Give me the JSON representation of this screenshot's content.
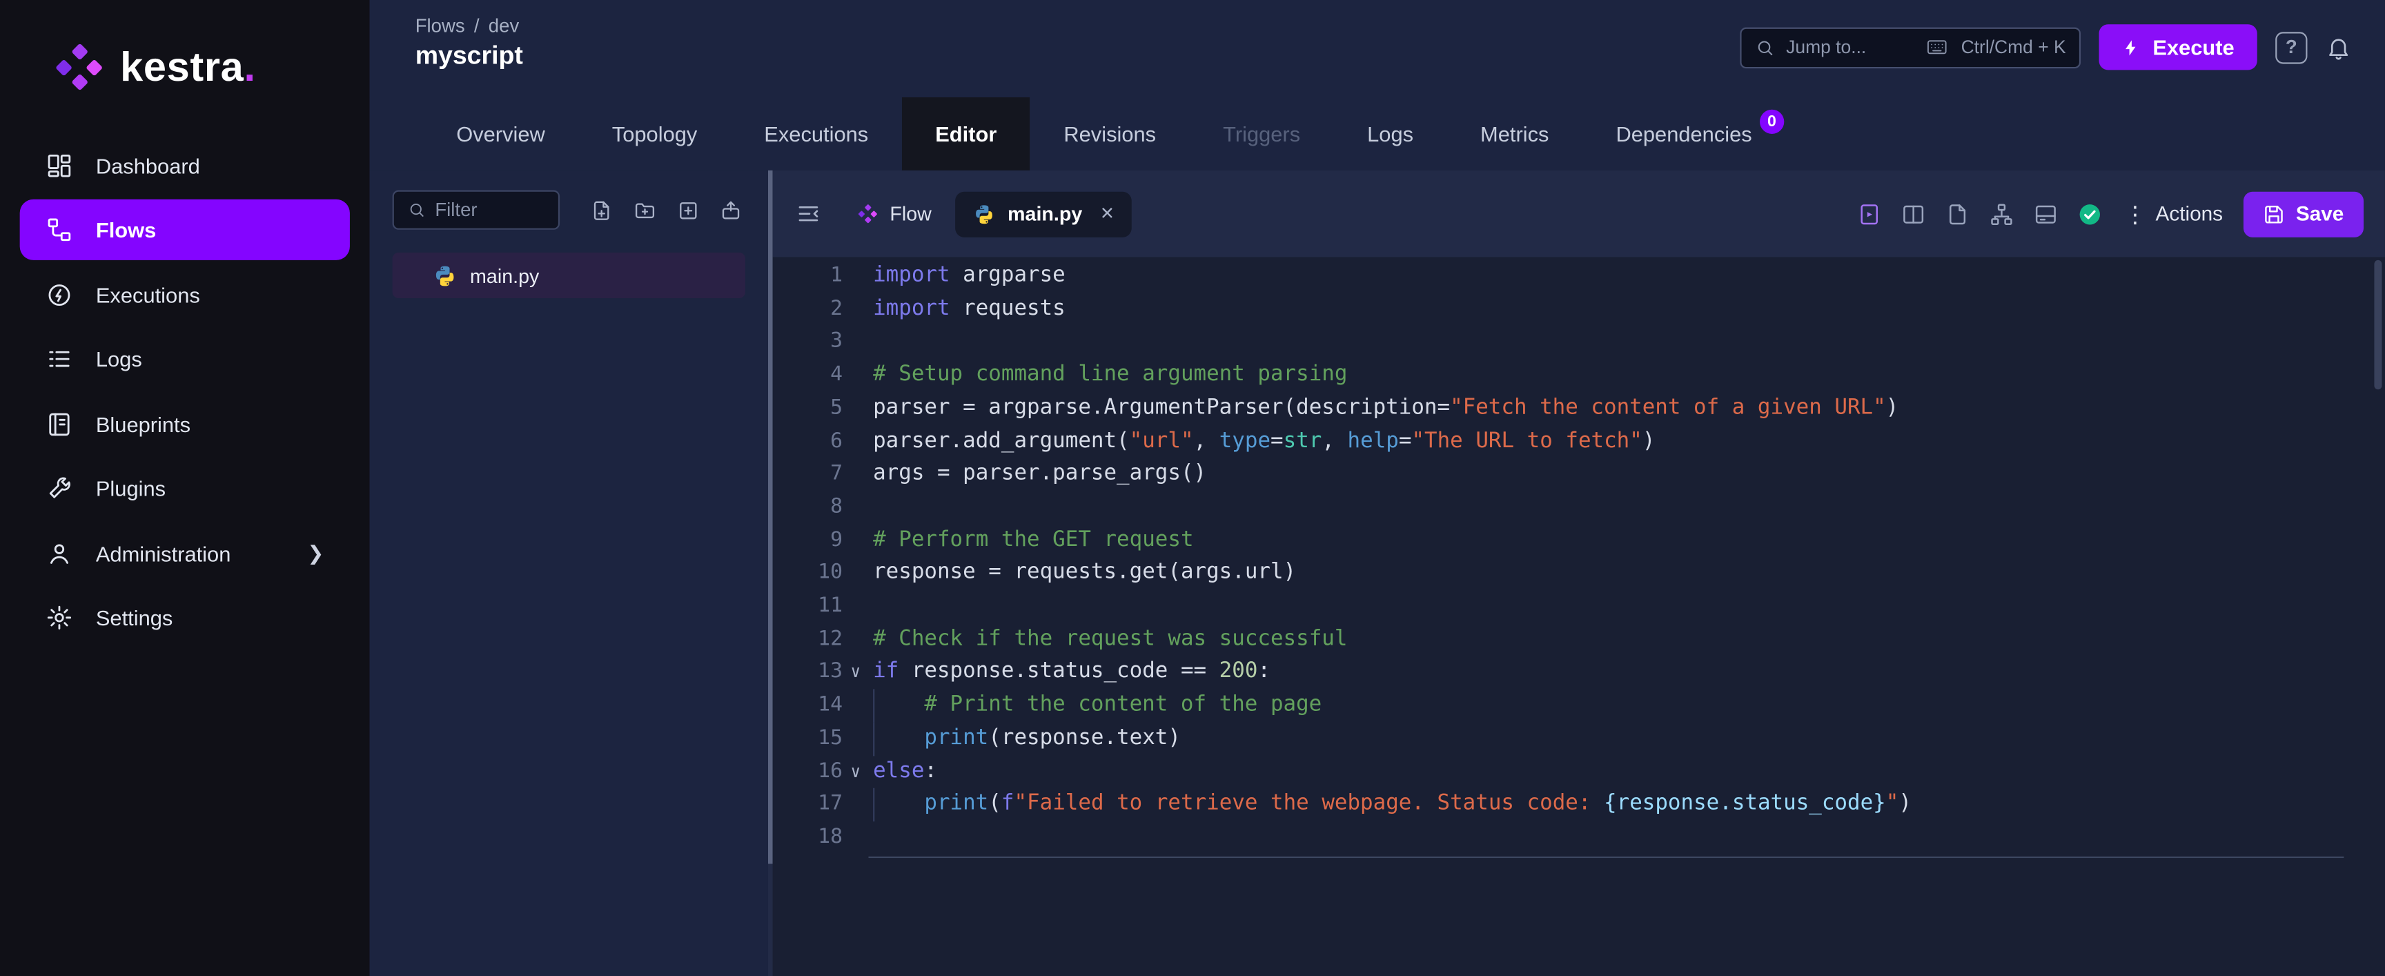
{
  "colors": {
    "brand_purple": "#8405FF",
    "header_bg": "#1C2440",
    "editor_bg": "#191F33",
    "sidebar_bg": "#101017",
    "save_purple": "#7A22EE",
    "execute_purple": "#8A0EF8",
    "selected_file_bg": "#2A2145",
    "check_green": "#12B886",
    "python_blue": "#4B8BBE",
    "python_yellow": "#FFD43B"
  },
  "icons": {
    "kebab": "⋮",
    "close": "×",
    "fold_chevron": "∨",
    "chevron_right": "❯",
    "help": "?"
  },
  "sidebar": {
    "logo_text": "kestra",
    "logo_dot": ".",
    "items": [
      {
        "label": "Dashboard"
      },
      {
        "label": "Flows",
        "active": true
      },
      {
        "label": "Executions"
      },
      {
        "label": "Logs"
      },
      {
        "label": "Blueprints"
      },
      {
        "label": "Plugins"
      },
      {
        "label": "Administration",
        "chevron": true
      },
      {
        "label": "Settings"
      }
    ]
  },
  "header": {
    "breadcrumb": {
      "parent": "Flows",
      "separator": "/",
      "current": "dev"
    },
    "title": "myscript",
    "jump": {
      "placeholder": "Jump to...",
      "shortcut": "Ctrl/Cmd + K"
    },
    "execute_label": "Execute"
  },
  "tabs": [
    {
      "label": "Overview"
    },
    {
      "label": "Topology"
    },
    {
      "label": "Executions"
    },
    {
      "label": "Editor",
      "active": true
    },
    {
      "label": "Revisions"
    },
    {
      "label": "Triggers",
      "disabled": true
    },
    {
      "label": "Logs"
    },
    {
      "label": "Metrics"
    },
    {
      "label": "Dependencies",
      "badge": "0"
    }
  ],
  "explorer": {
    "filter_placeholder": "Filter",
    "files": [
      {
        "name": "main.py",
        "selected": true
      }
    ]
  },
  "editor": {
    "tabs": [
      {
        "label": "Flow"
      },
      {
        "label": "main.py",
        "active": true,
        "closable": true
      }
    ],
    "actions_label": "Actions",
    "save_label": "Save",
    "code": {
      "language": "python",
      "folds": [
        13,
        16
      ],
      "lines": [
        [
          [
            "kw",
            "import"
          ],
          [
            "pl",
            " argparse"
          ]
        ],
        [
          [
            "kw",
            "import"
          ],
          [
            "pl",
            " requests"
          ]
        ],
        [],
        [
          [
            "com",
            "# Setup command line argument parsing"
          ]
        ],
        [
          [
            "pl",
            "parser = argparse.ArgumentParser(description="
          ],
          [
            "str",
            "\"Fetch the content of a given URL\""
          ],
          [
            "pl",
            ")"
          ]
        ],
        [
          [
            "pl",
            "parser.add_argument("
          ],
          [
            "str",
            "\"url\""
          ],
          [
            "pl",
            ", "
          ],
          [
            "bi",
            "type"
          ],
          [
            "pl",
            "="
          ],
          [
            "cls",
            "str"
          ],
          [
            "pl",
            ", "
          ],
          [
            "bi",
            "help"
          ],
          [
            "pl",
            "="
          ],
          [
            "str",
            "\"The URL to fetch\""
          ],
          [
            "pl",
            ")"
          ]
        ],
        [
          [
            "pl",
            "args = parser.parse_args()"
          ]
        ],
        [],
        [
          [
            "com",
            "# Perform the GET request"
          ]
        ],
        [
          [
            "pl",
            "response = requests.get(args.url)"
          ]
        ],
        [],
        [
          [
            "com",
            "# Check if the request was successful"
          ]
        ],
        [
          [
            "kw",
            "if"
          ],
          [
            "pl",
            " response.status_code == "
          ],
          [
            "num",
            "200"
          ],
          [
            "pl",
            ":"
          ]
        ],
        [
          [
            "ind",
            "    "
          ],
          [
            "com",
            "# Print the content of the page"
          ]
        ],
        [
          [
            "ind",
            "    "
          ],
          [
            "bi",
            "print"
          ],
          [
            "pl",
            "(response.text)"
          ]
        ],
        [
          [
            "kw",
            "else"
          ],
          [
            "pl",
            ":"
          ]
        ],
        [
          [
            "ind",
            "    "
          ],
          [
            "bi",
            "print"
          ],
          [
            "pl",
            "("
          ],
          [
            "kw",
            "f"
          ],
          [
            "str",
            "\"Failed to retrieve the webpage. Status code: "
          ],
          [
            "interp",
            "{response.status_code}"
          ],
          [
            "str",
            "\""
          ],
          [
            "pl",
            ")"
          ]
        ],
        []
      ]
    }
  }
}
